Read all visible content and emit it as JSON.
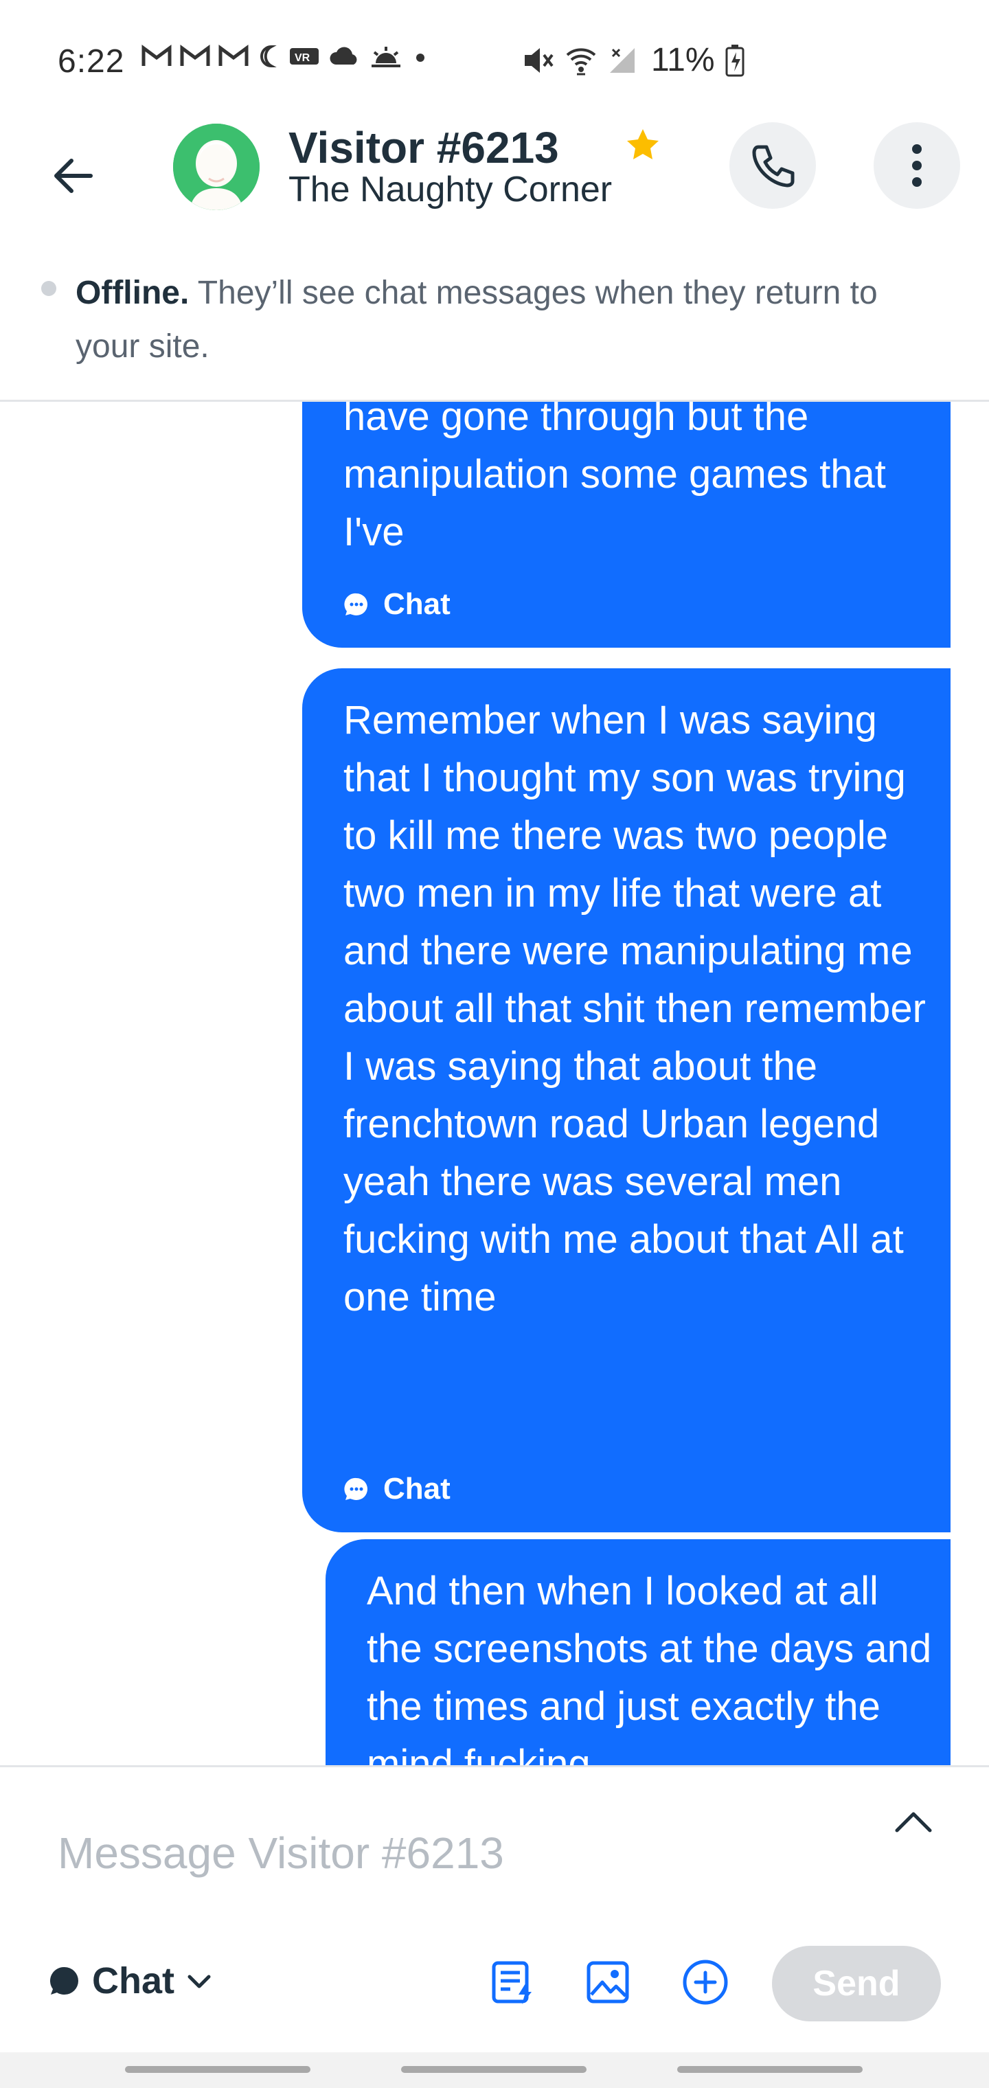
{
  "status_bar": {
    "time": "6:22",
    "battery": "11%",
    "icons": [
      "gmail-icon",
      "gmail-icon",
      "gmail-icon",
      "moon-icon",
      "vr-icon",
      "cloud-icon",
      "sunrise-icon",
      "dot-icon",
      "mute-icon",
      "wifi-icon",
      "signal-icon",
      "battery-charging-icon"
    ]
  },
  "header": {
    "visitor_name": "Visitor #6213",
    "site_name": "The Naughty Corner",
    "starred": true,
    "colors": {
      "avatar_bg": "#3cbf6e",
      "star": "#fcbd00"
    }
  },
  "offline_banner": {
    "status": "Offline.",
    "message": "They’ll see chat messages when they return to your site."
  },
  "messages": [
    {
      "text": "have gone through but the manipulation some games that I've",
      "channel": "Chat"
    },
    {
      "text": "Remember when I was saying that I thought my son was trying to kill me there was two people two men in my life that were at and there were manipulating me about all that shit then remember I was saying that about the frenchtown road Urban legend yeah there was several men fucking with me about that All at one time",
      "channel": "Chat"
    },
    {
      "text": "And then when I looked at all the screenshots at the days and the times and just exactly the mind fucking",
      "channel": ""
    }
  ],
  "composer": {
    "placeholder": "Message Visitor #6213",
    "channel_label": "Chat",
    "send_label": "Send"
  },
  "colors": {
    "bubble": "#116dff",
    "send_disabled": "#d8dadd",
    "accent": "#116dff"
  }
}
